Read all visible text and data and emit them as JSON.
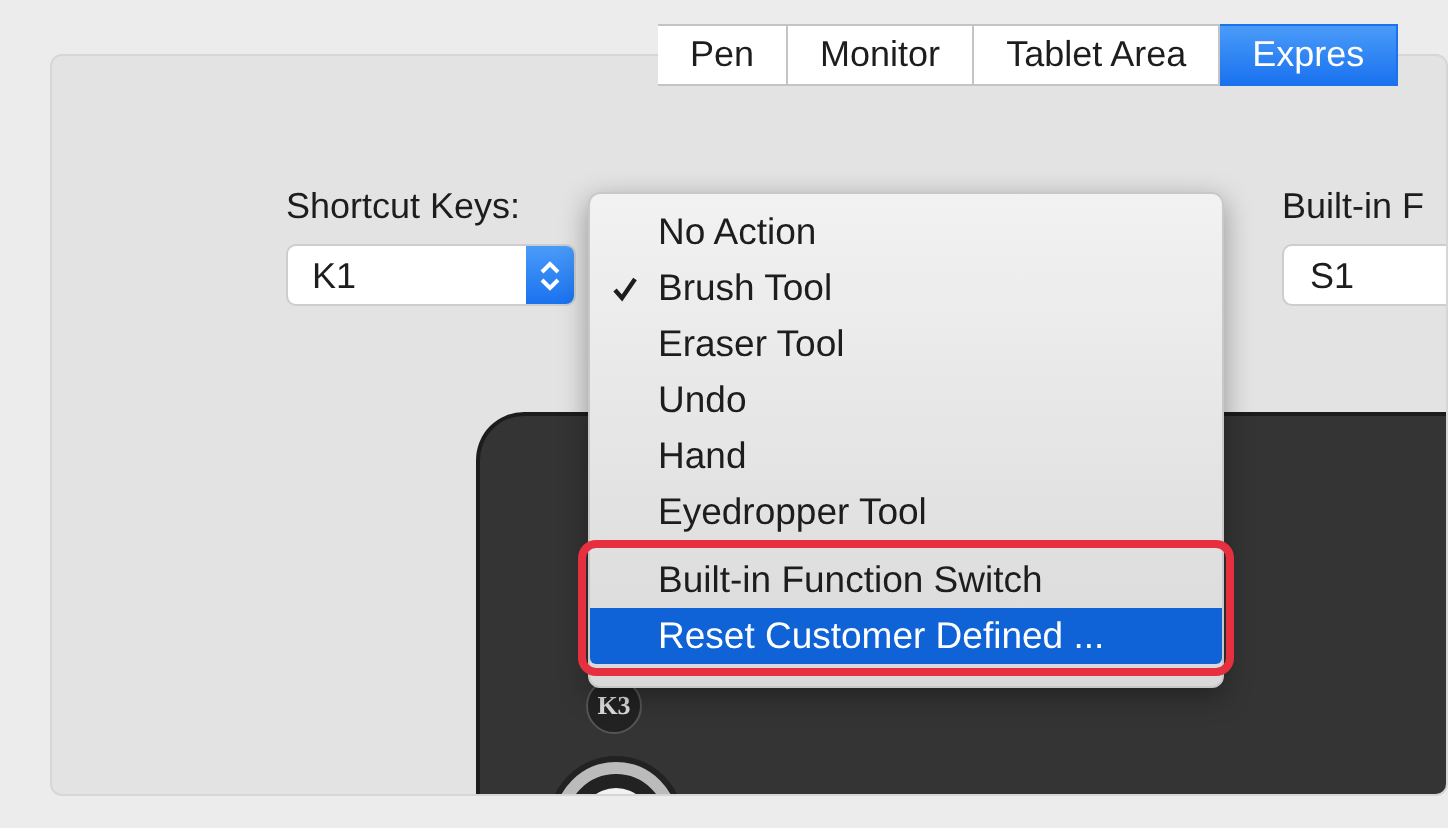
{
  "tabs": [
    {
      "label": "Pen",
      "selected": false
    },
    {
      "label": "Monitor",
      "selected": false
    },
    {
      "label": "Tablet Area",
      "selected": false
    },
    {
      "label": "Expres",
      "selected": true
    }
  ],
  "shortcut_keys": {
    "label": "Shortcut Keys:",
    "value": "K1"
  },
  "builtin_function": {
    "label": "Built-in F",
    "value": "S1"
  },
  "tablet": {
    "keys": [
      {
        "label": "K3"
      }
    ]
  },
  "menu": {
    "items": [
      {
        "label": "No Action",
        "checked": false,
        "selected": false,
        "boxed": false
      },
      {
        "label": "Brush Tool",
        "checked": true,
        "selected": false,
        "boxed": false
      },
      {
        "label": "Eraser Tool",
        "checked": false,
        "selected": false,
        "boxed": false
      },
      {
        "label": "Undo",
        "checked": false,
        "selected": false,
        "boxed": false
      },
      {
        "label": "Hand",
        "checked": false,
        "selected": false,
        "boxed": false
      },
      {
        "label": "Eyedropper Tool",
        "checked": false,
        "selected": false,
        "boxed": false
      },
      {
        "label": "Built-in Function Switch",
        "checked": false,
        "selected": false,
        "boxed": true
      },
      {
        "label": "Reset Customer Defined ...",
        "checked": false,
        "selected": true,
        "boxed": true
      }
    ]
  }
}
